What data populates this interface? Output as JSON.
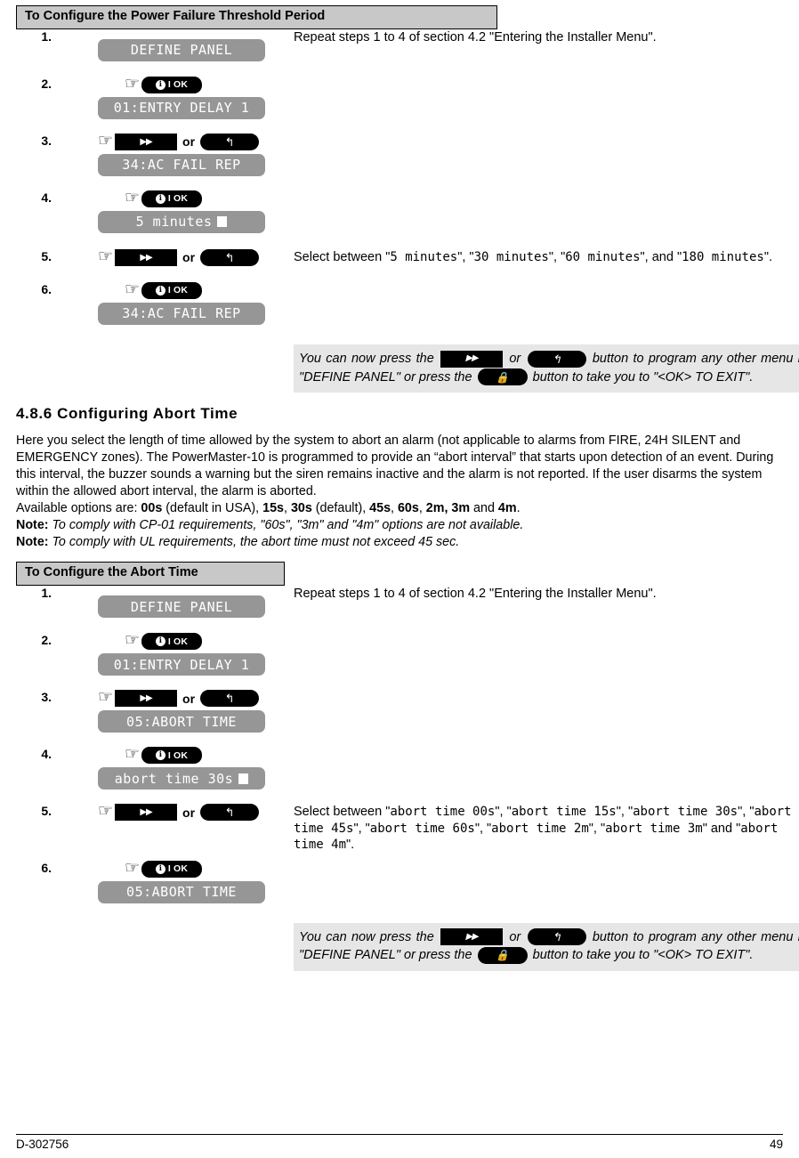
{
  "icons": {
    "hand": "☞",
    "fast_forward": "▶▶",
    "back_arrow": "↰",
    "lock": "🔒",
    "info": "i"
  },
  "keys": {
    "ok_label": "OK",
    "ok_separator": "I",
    "or_word": "or"
  },
  "section_power_failure": {
    "header": "To Configure the Power Failure Threshold Period",
    "steps": [
      {
        "num": "1.",
        "display": "DEFINE PANEL",
        "text": "Repeat steps 1 to 4 of section 4.2 \"Entering the Installer Menu\"."
      },
      {
        "num": "2.",
        "display": "01:ENTRY DELAY 1",
        "text": ""
      },
      {
        "num": "3.",
        "display": "34:AC FAIL REP",
        "text": ""
      },
      {
        "num": "4.",
        "display": "5 minutes",
        "text": ""
      },
      {
        "num": "5.",
        "display": "",
        "text_lead": "Select between ",
        "options": [
          "5 minutes",
          "30 minutes",
          "60 minutes",
          "180 minutes"
        ]
      },
      {
        "num": "6.",
        "display": "34:AC FAIL REP",
        "text": ""
      }
    ],
    "note": {
      "p1": "You can now press the",
      "p2": "or",
      "p3": "button to program any other menu in",
      "menu_name": "\"DEFINE PANEL\"",
      "p4": "or press the",
      "p5": "button to take you to",
      "exit_name": "\"<OK> TO EXIT\"",
      "p6": "."
    }
  },
  "section_abort": {
    "heading": "4.8.6 Configuring Abort Time",
    "paragraph1": "Here you select the length of time allowed by the system to abort an alarm (not applicable to alarms from FIRE, 24H SILENT and EMERGENCY zones). The PowerMaster-10 is programmed to provide an “abort interval” that starts upon detection of an event. During this interval, the buzzer sounds a warning but the siren remains inactive and the alarm is not reported. If the user disarms the system within the allowed abort interval, the alarm is aborted.",
    "options_lead": "Available options are: ",
    "options": [
      "00s",
      "15s",
      "30s",
      "45s",
      "60s",
      "2m, 3m",
      "4m"
    ],
    "options_line": "Available options are: 00s (default in USA), 15s, 30s (default), 45s, 60s, 2m, 3m and 4m.",
    "note1_label": "Note:",
    "note1_text": "To comply with CP-01 requirements, \"60s\", \"3m\" and \"4m\" options are not available.",
    "note2_label": "Note:",
    "note2_text": "To comply with UL requirements, the abort time must not exceed 45 sec.",
    "header": "To Configure the Abort Time",
    "steps": [
      {
        "num": "1.",
        "display": "DEFINE PANEL",
        "text": "Repeat steps 1 to 4 of section 4.2 \"Entering the Installer Menu\"."
      },
      {
        "num": "2.",
        "display": "01:ENTRY DELAY 1",
        "text": ""
      },
      {
        "num": "3.",
        "display": "05:ABORT TIME",
        "text": ""
      },
      {
        "num": "4.",
        "display": "abort time 30s",
        "text": ""
      },
      {
        "num": "5.",
        "display": "",
        "text_lead": "Select between ",
        "options": [
          "abort time 00s",
          "abort time 15s",
          "abort time 30s",
          "abort time 45s",
          "abort time 60s",
          "abort time 2m",
          "abort time 3m",
          "abort time 4m"
        ]
      },
      {
        "num": "6.",
        "display": "05:ABORT TIME",
        "text": ""
      }
    ],
    "note": {
      "p1": "You can now press the",
      "p2": "or",
      "p3": "button to program any other menu in",
      "menu_name": "\"DEFINE PANEL\"",
      "p4": "or press the",
      "p5": "button to take you to",
      "exit_name": "\"<OK> TO EXIT\"",
      "p6": "."
    }
  },
  "footer": {
    "doc_number": "D-302756",
    "page_number": "49"
  },
  "colors": {
    "header_bar": "#c8c8c8",
    "lcd_bg": "#969696",
    "note_bg": "#e6e6e6",
    "key_bg": "#000000"
  }
}
